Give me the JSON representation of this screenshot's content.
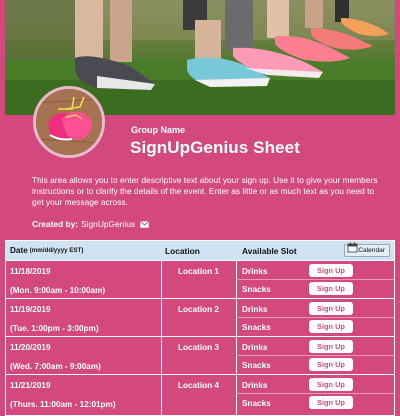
{
  "header": {
    "group_label": "Group Name",
    "title": "SignUpGenius Sheet",
    "description": "This area allows you to enter descriptive text about your sign up. Use it to give your members instructions or to clarify the details of the event. Enter as little or as much text as you need to get your message across.",
    "created_by_label": "Created by:",
    "created_by_name": "SignUpGenius"
  },
  "table": {
    "headers": {
      "date": "Date",
      "date_format": "(mm/dd/yyyy EST)",
      "location": "Location",
      "slot": "Available Slot",
      "calendar_button": "Calendar"
    },
    "rows": [
      {
        "date": "11/18/2019",
        "time": "(Mon. 9:00am - 10:00am)",
        "location": "Location 1",
        "slots": [
          {
            "name": "Drinks",
            "button": "Sign Up"
          },
          {
            "name": "Snacks",
            "button": "Sign Up"
          }
        ]
      },
      {
        "date": "11/19/2019",
        "time": "(Tue. 1:00pm - 3:00pm)",
        "location": "Location 2",
        "slots": [
          {
            "name": "Drinks",
            "button": "Sign Up"
          },
          {
            "name": "Snacks",
            "button": "Sign Up"
          }
        ]
      },
      {
        "date": "11/20/2019",
        "time": "(Wed. 7:00am - 9:00am)",
        "location": "Location 3",
        "slots": [
          {
            "name": "Drinks",
            "button": "Sign Up"
          },
          {
            "name": "Snacks",
            "button": "Sign Up"
          }
        ]
      },
      {
        "date": "11/21/2019",
        "time": "(Thurs. 11:00am - 12:01pm)",
        "location": "Location 4",
        "slots": [
          {
            "name": "Drinks",
            "button": "Sign Up"
          },
          {
            "name": "Snacks",
            "button": "Sign Up"
          }
        ]
      }
    ]
  },
  "colors": {
    "page_background": "#d3497e",
    "header_row": "#cfe3f2",
    "button_background": "#ffffff",
    "button_text": "#d3497e"
  },
  "icons": {
    "mail": "envelope-icon",
    "calendar": "calendar-icon"
  }
}
